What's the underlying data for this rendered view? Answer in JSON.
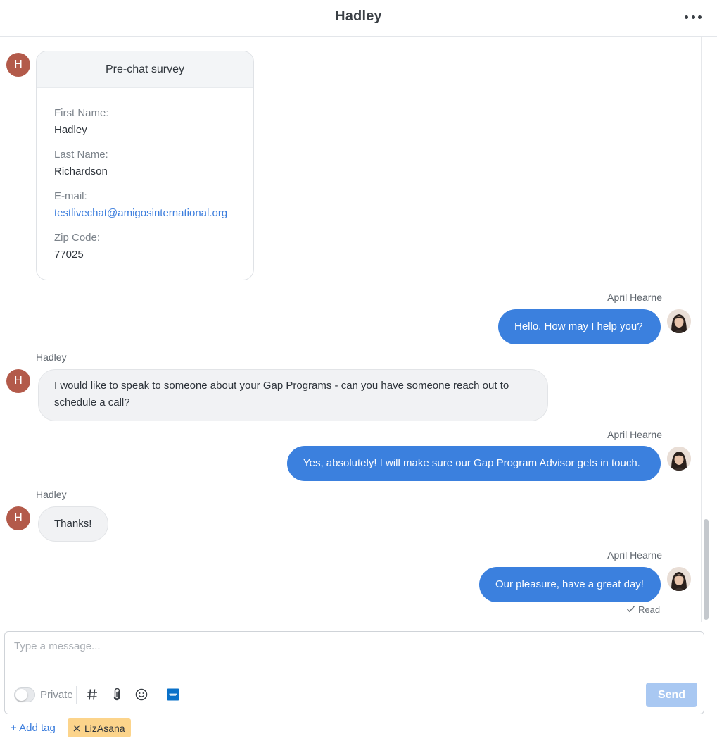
{
  "header": {
    "title": "Hadley"
  },
  "survey": {
    "title": "Pre-chat survey",
    "fields": [
      {
        "label": "First Name:",
        "value": "Hadley"
      },
      {
        "label": "Last Name:",
        "value": "Richardson"
      },
      {
        "label": "E-mail:",
        "value": "testlivechat@amigosinternational.org"
      },
      {
        "label": "Zip Code:",
        "value": "77025"
      }
    ]
  },
  "visitor": {
    "initial": "H",
    "name": "Hadley"
  },
  "agent": {
    "name": "April Hearne"
  },
  "messages": [
    {
      "from": "agent",
      "sender": "April Hearne",
      "text": "Hello. How may I help you?"
    },
    {
      "from": "visitor",
      "sender": "Hadley",
      "text": "I would like to speak to someone about your Gap Programs - can you have someone reach out to schedule a call?"
    },
    {
      "from": "agent",
      "sender": "April Hearne",
      "text": "Yes, absolutely! I will make sure our Gap Program Advisor gets in touch."
    },
    {
      "from": "visitor",
      "sender": "Hadley",
      "text": "Thanks!"
    },
    {
      "from": "agent",
      "sender": "April Hearne",
      "text": "Our pleasure, have a great day!"
    }
  ],
  "read_status": "Read",
  "composer": {
    "placeholder": "Type a message...",
    "private_label": "Private",
    "send_label": "Send"
  },
  "tags": {
    "add_label": "+ Add tag",
    "items": [
      "LizAsana"
    ]
  },
  "colors": {
    "agent_bubble": "#3b80de",
    "visitor_avatar": "#b35a4a",
    "tag_bg": "#fcd48b",
    "link": "#3b7ddd"
  }
}
